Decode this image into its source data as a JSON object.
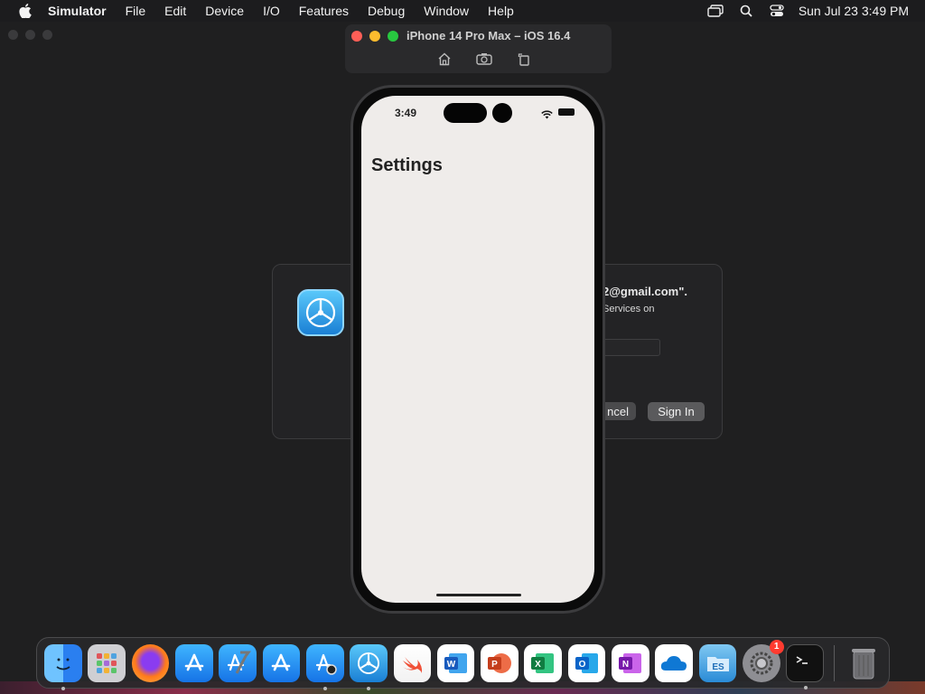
{
  "menubar": {
    "app_name": "Simulator",
    "items": [
      "File",
      "Edit",
      "Device",
      "I/O",
      "Features",
      "Debug",
      "Window",
      "Help"
    ],
    "clock": "Sun Jul 23  3:49 PM"
  },
  "simulator": {
    "window_title": "iPhone 14 Pro Max – iOS 16.4",
    "tools": [
      "home-icon",
      "screenshot-icon",
      "rotate-icon"
    ]
  },
  "iphone": {
    "status_time": "3:49",
    "page_title": "Settings"
  },
  "dialog": {
    "email_text": "2@gmail.com\".",
    "sub_text": "Services on",
    "cancel_label": "ncel",
    "signin_label": "Sign In"
  },
  "dock": {
    "items": [
      {
        "name": "finder",
        "color": "#3d8ef7"
      },
      {
        "name": "launchpad",
        "color": "#d9d9d9"
      },
      {
        "name": "firefox",
        "color": "#ff7a1a"
      },
      {
        "name": "app-store",
        "color": "#1e8ff5"
      },
      {
        "name": "xcode",
        "color": "#2a7ad8"
      },
      {
        "name": "app-store-2",
        "color": "#1e8ff5"
      },
      {
        "name": "instruments",
        "color": "#2a7ad8"
      },
      {
        "name": "simulator",
        "color": "#2d95e6"
      },
      {
        "name": "swift",
        "color": "#f05138"
      },
      {
        "name": "word",
        "color": "#2b579a",
        "glyph": "W"
      },
      {
        "name": "powerpoint",
        "color": "#d24726",
        "glyph": "P"
      },
      {
        "name": "excel",
        "color": "#217346",
        "glyph": "X"
      },
      {
        "name": "outlook",
        "color": "#0a64c8",
        "glyph": "O"
      },
      {
        "name": "onenote",
        "color": "#7719aa",
        "glyph": "N"
      },
      {
        "name": "onedrive",
        "color": "#0f78d4"
      },
      {
        "name": "file-explorer",
        "color": "#3a9bd8"
      },
      {
        "name": "system-settings",
        "color": "#8e8e93",
        "badge": "1"
      },
      {
        "name": "terminal",
        "color": "#111111"
      }
    ],
    "trash": "trash-icon"
  }
}
